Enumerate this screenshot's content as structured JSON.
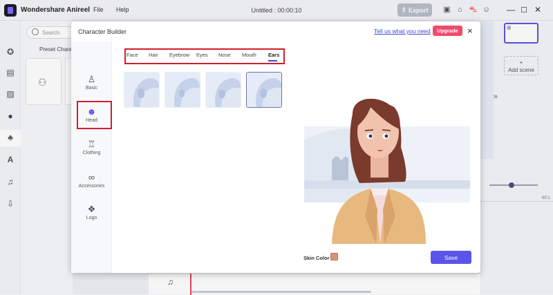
{
  "app": {
    "name": "Wondershare Anireel",
    "menu": [
      "File",
      "Help"
    ],
    "doc_title": "Untitled : 00:00:10",
    "export_label": "Export"
  },
  "left_panel": {
    "search_placeholder": "Search",
    "preset_label": "Preset Characte"
  },
  "right_panel": {
    "add_scene_icon": "+",
    "add_scene_label": "Add scene",
    "expand_icon": "»",
    "time_label": "00:1"
  },
  "modal": {
    "title": "Character Builder",
    "feedback_link": "Tell us what you need",
    "upgrade_label": "Upgrade",
    "close_icon": "×",
    "side_nav": [
      {
        "label": "Basic",
        "icon": "person-icon"
      },
      {
        "label": "Head",
        "icon": "head-icon"
      },
      {
        "label": "Clothing",
        "icon": "shirt-icon"
      },
      {
        "label": "Accessories",
        "icon": "glasses-icon"
      },
      {
        "label": "Logo",
        "icon": "logo-icon"
      }
    ],
    "tabs": [
      "Face",
      "Hair",
      "Eyebrow",
      "Eyes",
      "Nose",
      "Mouth",
      "Ears"
    ],
    "active_tab": "Ears",
    "ear_options_count": 4,
    "selected_ear_index": 3,
    "skin_color_label": "Skin Color",
    "skin_color": "#d8927e",
    "save_label": "Save"
  },
  "colors": {
    "accent": "#5b54e8",
    "upgrade": "#f24b6a",
    "highlight": "#d21d2c"
  }
}
